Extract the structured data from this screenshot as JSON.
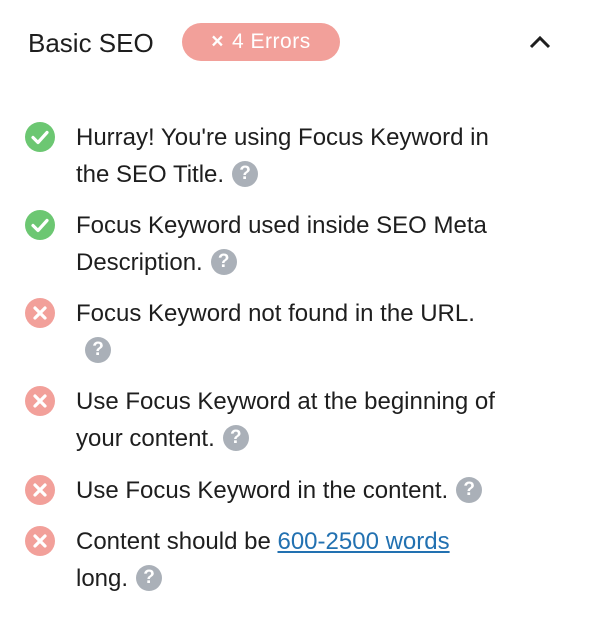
{
  "header": {
    "title": "Basic SEO",
    "badge_icon": "×",
    "badge_label": "4 Errors",
    "toggle_icon": "chevron-up-icon"
  },
  "colors": {
    "success": "#6cc772",
    "error": "#f2a09a",
    "help": "#aab0b8",
    "link": "#2271b1"
  },
  "items": [
    {
      "status": "ok",
      "line1": "Hurray! You're using Focus Keyword in",
      "line2": "the SEO Title.",
      "help": "?"
    },
    {
      "status": "ok",
      "line1": "Focus Keyword used inside SEO Meta",
      "line2": "Description.",
      "help": "?"
    },
    {
      "status": "error",
      "line1": "Focus Keyword not found in the URL.",
      "help": "?"
    },
    {
      "status": "error",
      "line1": "Use Focus Keyword at the beginning of",
      "line2": "your content.",
      "help": "?"
    },
    {
      "status": "error",
      "line1": "Use Focus Keyword in the content.",
      "help": "?"
    },
    {
      "status": "error",
      "line1_prefix": "Content should be ",
      "link": "600-2500 words",
      "line2": "long.",
      "help": "?"
    }
  ]
}
